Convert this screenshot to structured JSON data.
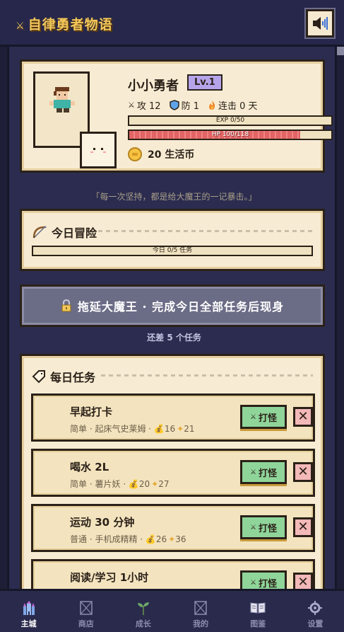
{
  "header": {
    "title": "自律勇者物语",
    "sword_glyph": "⚔",
    "sound_icon": "speaker-icon"
  },
  "profile": {
    "name": "小小勇者",
    "level": "Lv.1",
    "attack_label": "攻 12",
    "defense_label": "防 1",
    "streak_label": "连击 0 天",
    "exp_label": "EXP 0/50",
    "exp_fraction": 0,
    "hp_label": "HP 100/118",
    "hp_fraction": 0.847,
    "coins_label": "20 生活币"
  },
  "quote": "「每一次坚持，都是给大魔王的一记暴击。」",
  "adventure": {
    "title": "今日冒险",
    "progress_label": "今日 0/5 任务",
    "progress_fraction": 0
  },
  "boss": {
    "label": "拖延大魔王 · 完成今日全部任务后现身",
    "note": "还差 5 个任务"
  },
  "tasks": {
    "title": "每日任务",
    "fight_label": "打怪",
    "close_glyph": "✕",
    "items": [
      {
        "name": "早起打卡",
        "meta": "简单 · 起床气史莱姆 · ",
        "gold": "16",
        "exp": "21"
      },
      {
        "name": "喝水 2L",
        "meta": "简单 · 薯片妖 · ",
        "gold": "20",
        "exp": "27"
      },
      {
        "name": "运动 30 分钟",
        "meta": "普通 · 手机成精精 · ",
        "gold": "26",
        "exp": "36"
      },
      {
        "name": "阅读/学习 1小时",
        "meta": "",
        "gold": "",
        "exp": ""
      }
    ]
  },
  "nav": {
    "items": [
      {
        "label": "主城",
        "icon": "castle-icon",
        "active": true
      },
      {
        "label": "商店",
        "icon": "shop-icon",
        "active": false
      },
      {
        "label": "成长",
        "icon": "sprout-icon",
        "active": false
      },
      {
        "label": "我的",
        "icon": "user-icon",
        "active": false
      },
      {
        "label": "图鉴",
        "icon": "book-icon",
        "active": false
      },
      {
        "label": "设置",
        "icon": "gear-icon",
        "active": false
      }
    ]
  },
  "colors": {
    "accent": "#f3c75a",
    "card": "#f7ecd3",
    "fight_button": "#8fd59a",
    "close_button": "#f3b8b8",
    "hp": "#e26464",
    "level_badge": "#b6a4ea"
  }
}
